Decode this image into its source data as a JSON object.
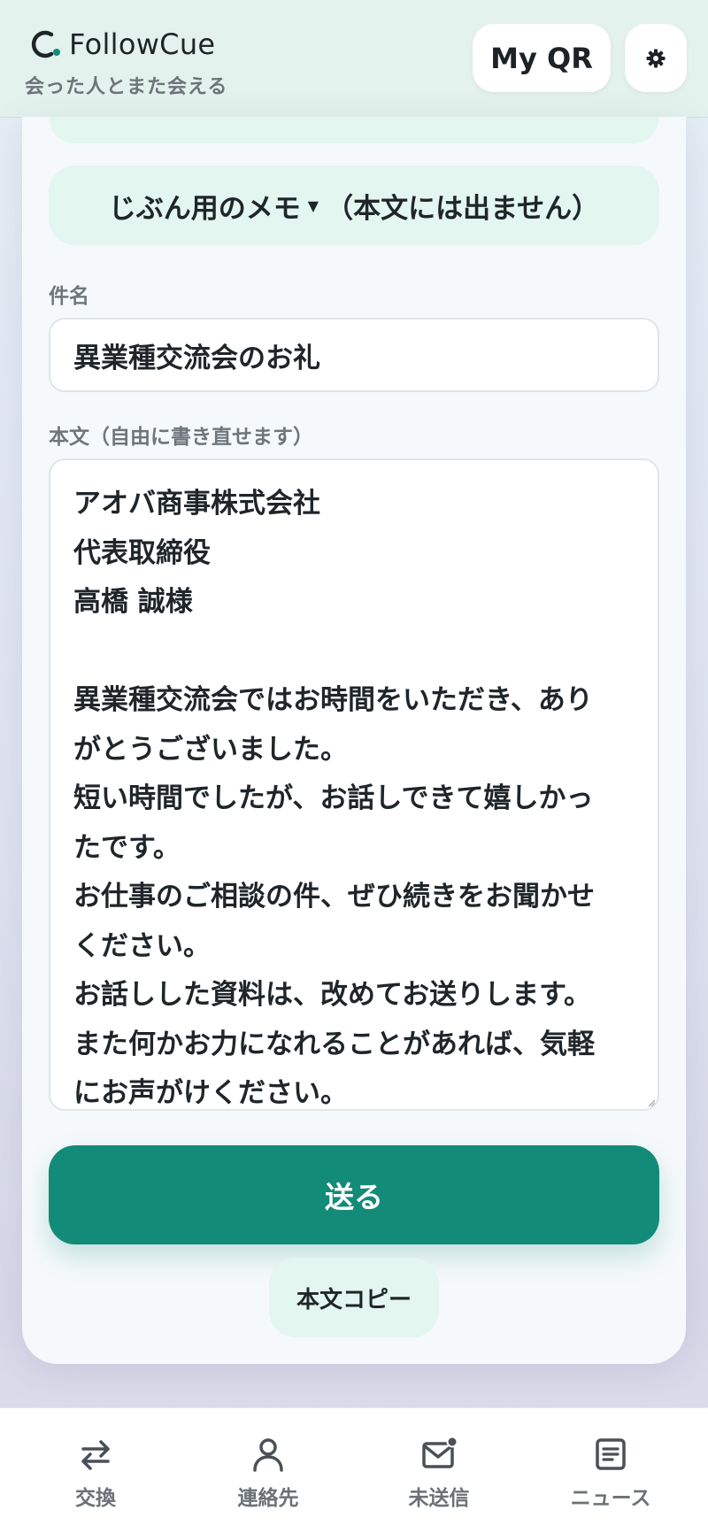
{
  "header": {
    "brand_name": "FollowCue",
    "tagline": "会った人とまた会える",
    "myqr_label": "My QR",
    "settings_icon": "gear-icon"
  },
  "form": {
    "memo_toggle_label": "じぶん用のメモ",
    "memo_toggle_arrow": "▼",
    "memo_toggle_note": "（本文には出ません）",
    "subject_label": "件名",
    "subject_value": "異業種交流会のお礼",
    "body_label": "本文（自由に書き直せます）",
    "body_lines": [
      "アオバ商事株式会社",
      "代表取締役",
      "高橋 誠様",
      "",
      "異業種交流会ではお時間をいただき、あり",
      "がとうございました。",
      "短い時間でしたが、お話しできて嬉しかっ",
      "たです。",
      "お仕事のご相談の件、ぜひ続きをお聞かせ",
      "ください。",
      "お話しした資料は、改めてお送りします。",
      "また何かお力になれることがあれば、気軽",
      "にお声がけください。"
    ],
    "send_label": "送る",
    "copy_label": "本文コピー"
  },
  "nav": {
    "items": [
      {
        "label": "交換",
        "icon": "swap-icon"
      },
      {
        "label": "連絡先",
        "icon": "person-icon"
      },
      {
        "label": "未送信",
        "icon": "mail-icon"
      },
      {
        "label": "ニュース",
        "icon": "news-icon"
      }
    ]
  },
  "colors": {
    "accent": "#138b79",
    "mint": "#e3f6f0",
    "header_bg": "#e3f2ec"
  }
}
